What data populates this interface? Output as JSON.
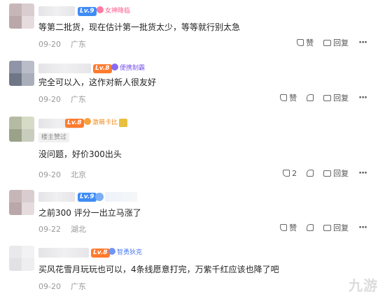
{
  "comments": [
    {
      "level": "Lv.9",
      "badge": "女神降临",
      "text": "等第二批货，现在估计第一批货太少，等等就行别太急",
      "date": "09-20",
      "location": "广东",
      "like_label": "赞",
      "reply_label": "回复",
      "more": "···"
    },
    {
      "level": "Lv.8",
      "badge": "便携制霸",
      "text": "完全可以入，这作对新人很友好",
      "date": "09-20",
      "location": "广东",
      "like_label": "赞",
      "reply_label": "回复",
      "more": "···"
    },
    {
      "level": "Lv.8",
      "badge": "激萌卡比",
      "louzhu": "楼主赞过",
      "text": "没问题，好价300出头",
      "date": "09-20",
      "location": "北京",
      "like_count": "2",
      "reply_label": "回复",
      "more": "···"
    },
    {
      "level": "Lv.9",
      "text": "之前300 评分一出立马涨了",
      "date": "09-22",
      "location": "湖北",
      "like_label": "赞",
      "reply_label": "回复",
      "more": "···"
    },
    {
      "level": "Lv.8",
      "badge": "智勇狄克",
      "text": "买风花雪月玩玩也可以，4条线愿意打完，万紫千红应该也降了吧",
      "date": "09-20",
      "location": "广东"
    }
  ],
  "watermark": "九游",
  "colors": {
    "level_blue": "#3f8cf5",
    "level_orange": "#ff7b2e",
    "meta_gray": "#999999"
  }
}
